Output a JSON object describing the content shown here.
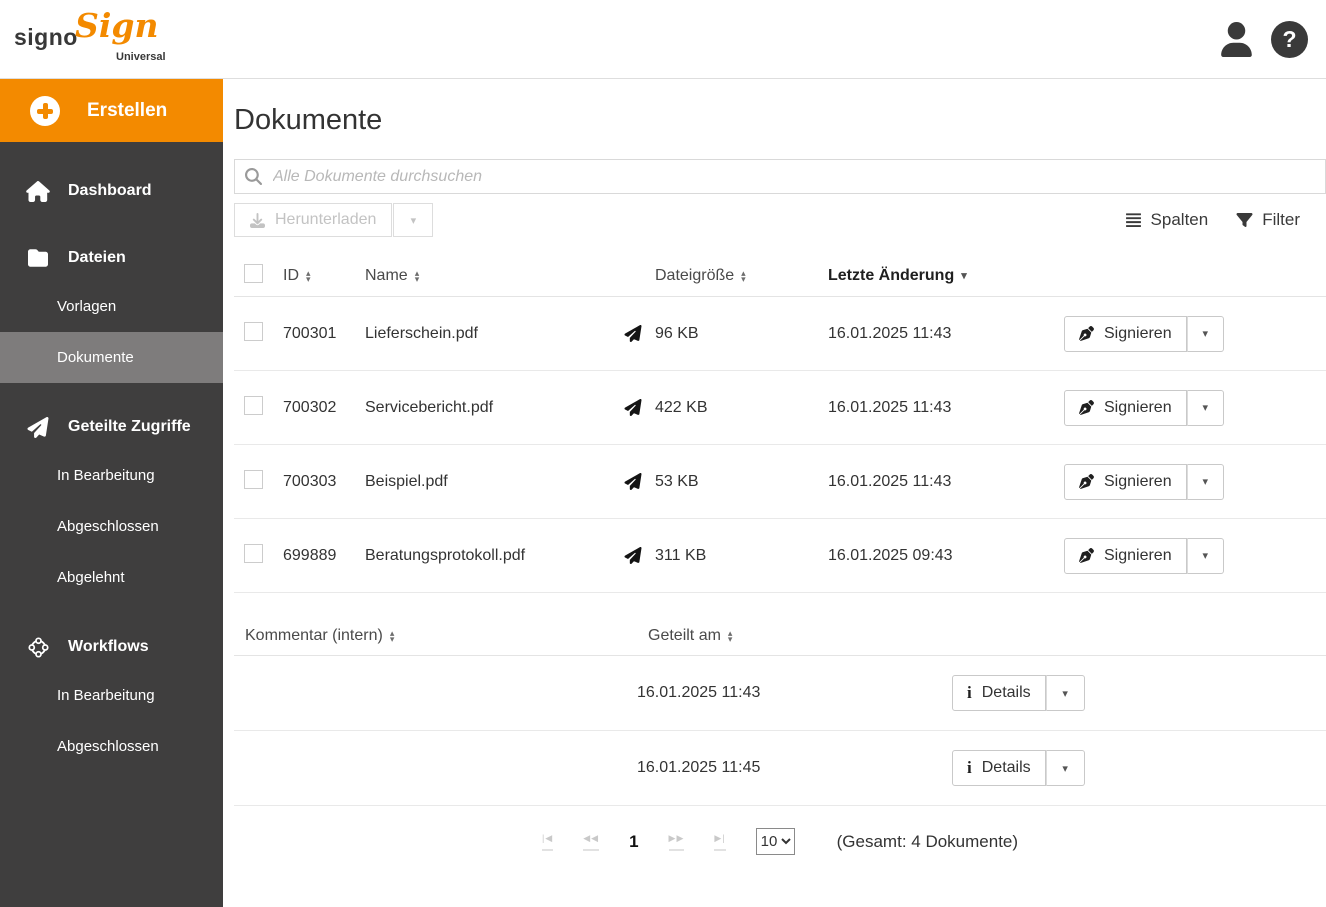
{
  "brand": {
    "logo_part1": "signo",
    "logo_part2": "Sign",
    "logo_subtitle": "Universal",
    "help_glyph": "?"
  },
  "sidebar": {
    "create_label": "Erstellen",
    "sections": [
      {
        "label": "Dashboard"
      },
      {
        "label": "Dateien",
        "children": [
          {
            "label": "Vorlagen"
          },
          {
            "label": "Dokumente",
            "active": true
          }
        ]
      },
      {
        "label": "Geteilte Zugriffe",
        "children": [
          {
            "label": "In Bearbeitung"
          },
          {
            "label": "Abgeschlossen"
          },
          {
            "label": "Abgelehnt"
          }
        ]
      },
      {
        "label": "Workflows",
        "children": [
          {
            "label": "In Bearbeitung"
          },
          {
            "label": "Abgeschlossen"
          }
        ]
      }
    ]
  },
  "main": {
    "title": "Dokumente",
    "search": {
      "placeholder": "Alle Dokumente durchsuchen"
    },
    "toolbar": {
      "download_label": "Herunterladen",
      "columns_label": "Spalten",
      "filter_label": "Filter"
    },
    "documents_table": {
      "headers": {
        "id": "ID",
        "name": "Name",
        "size": "Dateigröße",
        "modified": "Letzte Änderung"
      },
      "sign_label": "Signieren",
      "rows": [
        {
          "id": "700301",
          "name": "Lieferschein.pdf",
          "size": "96 KB",
          "modified": "16.01.2025 11:43",
          "shared": true
        },
        {
          "id": "700302",
          "name": "Servicebericht.pdf",
          "size": "422 KB",
          "modified": "16.01.2025 11:43",
          "shared": true
        },
        {
          "id": "700303",
          "name": "Beispiel.pdf",
          "size": "53 KB",
          "modified": "16.01.2025 11:43",
          "shared": true
        },
        {
          "id": "699889",
          "name": "Beratungsprotokoll.pdf",
          "size": "311 KB",
          "modified": "16.01.2025 09:43",
          "shared": true
        }
      ]
    },
    "shared_table": {
      "headers": {
        "comment": "Kommentar (intern)",
        "shared_at": "Geteilt am"
      },
      "details_label": "Details",
      "rows": [
        {
          "comment": "",
          "shared_at": "16.01.2025 11:43"
        },
        {
          "comment": "",
          "shared_at": "16.01.2025 11:45"
        }
      ]
    },
    "pagination": {
      "page": "1",
      "page_size": "10",
      "total_label": "(Gesamt: 4 Dokumente)"
    }
  },
  "icons": {
    "caret_down": "▾",
    "sort_asc": "▴",
    "sort_desc": "▾",
    "pager_first": "|◀",
    "pager_prev": "◀◀",
    "pager_next": "▶▶",
    "pager_last": "▶|"
  },
  "colors": {
    "accent": "#F38A00",
    "sidebar_bg": "#3F3E3E",
    "sidebar_active_bg": "#7E7C7C"
  }
}
